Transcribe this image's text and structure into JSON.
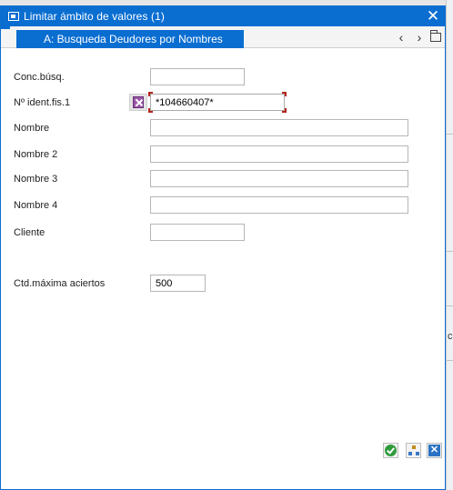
{
  "window": {
    "title": "Limitar ámbito de valores (1)",
    "close_glyph": "✕"
  },
  "tabs": {
    "active_label": "A: Busqueda Deudores por Nombres",
    "prev_glyph": "‹",
    "next_glyph": "›"
  },
  "form": {
    "conc_busq": {
      "label": "Conc.búsq.",
      "value": ""
    },
    "nif": {
      "label": "Nº ident.fis.1",
      "value": "*104660407*"
    },
    "nombre": {
      "label": "Nombre",
      "value": ""
    },
    "nombre2": {
      "label": "Nombre 2",
      "value": ""
    },
    "nombre3": {
      "label": "Nombre 3",
      "value": ""
    },
    "nombre4": {
      "label": "Nombre 4",
      "value": ""
    },
    "cliente": {
      "label": "Cliente",
      "value": ""
    },
    "max_hits": {
      "label": "Ctd.máxima aciertos",
      "value": "500"
    }
  },
  "footer": {
    "close_glyph": "✕"
  },
  "background": {
    "glyph": "ci"
  },
  "colors": {
    "accent": "#0a6ed1",
    "ok_green": "#2e9b3a",
    "selection_icon": "#9b57a7"
  }
}
